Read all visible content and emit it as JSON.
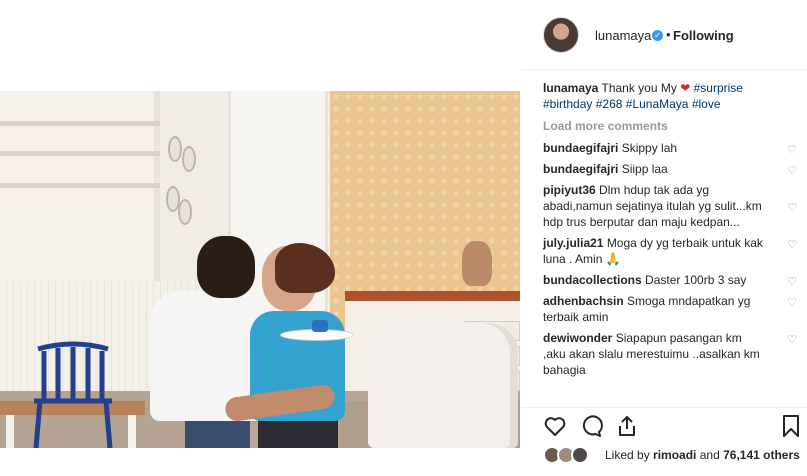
{
  "header": {
    "username": "lunamaya",
    "verified_icon": "verified-badge-icon",
    "separator": "•",
    "follow_status": "Following"
  },
  "caption": {
    "username": "lunamaya",
    "text_before_heart": "Thank you My",
    "heart_icon": "red-heart-emoji",
    "hashtag_1": "#surprise",
    "hashtag_2": "#birthday",
    "hashtag_3": "#268",
    "hashtag_4": "#LunaMaya",
    "hashtag_5": "#love"
  },
  "load_more_label": "Load more comments",
  "comments": [
    {
      "username": "bundaegifajri",
      "text": "Skippy lah"
    },
    {
      "username": "bundaegifajri",
      "text": "Siipp laa"
    },
    {
      "username": "pipiyut36",
      "text": "Dlm hdup tak ada yg abadi,namun sejatinya itulah yg sulit...km hdp trus berputar dan maju kedpan..."
    },
    {
      "username": "july.julia21",
      "text": "Moga dy yg terbaik untuk kak luna .  Amin 🙏"
    },
    {
      "username": "bundacollections",
      "text": "Daster 100rb 3 say"
    },
    {
      "username": "adhenbachsin",
      "text": "Smoga mndapatkan yg terbaik amin"
    },
    {
      "username": "dewiwonder",
      "text": "Siapapun pasangan km ,aku akan slalu merestuimu ..asalkan km bahagia"
    }
  ],
  "actions": {
    "like_icon": "heart-outline-icon",
    "comment_icon": "comment-bubble-icon",
    "share_icon": "share-upload-icon",
    "save_icon": "bookmark-icon"
  },
  "likes": {
    "text_prefix": "Liked by",
    "user": "rimoadi",
    "text_and": "and",
    "count": "76,141 others"
  },
  "colors": {
    "link": "#003569",
    "muted": "#999999",
    "verified": "#3897f0",
    "heart": "#e0263d"
  }
}
